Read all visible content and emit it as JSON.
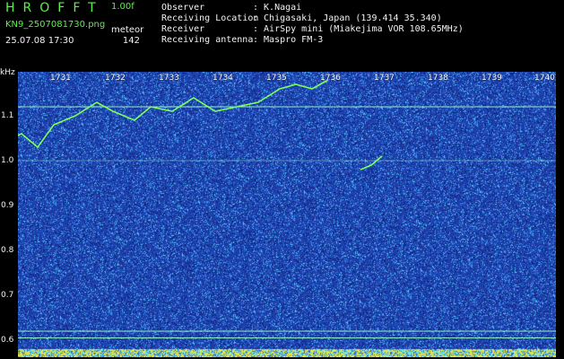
{
  "header": {
    "app_title": "HROFFT",
    "version": "1.00f",
    "filename": "KN9_2507081730.png",
    "meteor_label": "meteor",
    "datetime": "25.07.08 17:30",
    "meteor_count": "142",
    "info": [
      {
        "key": "Observer",
        "value": ": K.Nagai"
      },
      {
        "key": "Receiving Location",
        "value": ": Chigasaki, Japan (139.414 35.340)"
      },
      {
        "key": "Receiver",
        "value": ": AirSpy mini (Miakejima VOR 108.65MHz)"
      },
      {
        "key": "Receiving antenna",
        "value": ": Maspro FM-3"
      }
    ]
  },
  "chart_data": {
    "type": "heatmap",
    "ylabel": "kHz",
    "y_ticks": [
      "1.1",
      "1.0",
      "0.9",
      "0.8",
      "0.7",
      "0.6"
    ],
    "x_ticks": [
      "1731",
      "1732",
      "1733",
      "1734",
      "1735",
      "1736",
      "1737",
      "1738",
      "1739",
      "1740"
    ],
    "ylim": [
      0.58,
      1.2
    ],
    "reference_lines_khz": [
      1.12,
      1.0,
      0.62,
      0.605
    ],
    "colors": {
      "background": "#1c3aa3",
      "noise_light": "#4fb8ff",
      "noise_dark": "#0b1f73",
      "signal": "#7cff5a",
      "line": "#9fffc8",
      "axis_text": "#ffffff"
    },
    "traces": [
      {
        "x": [
          1730.0,
          1730.2,
          1730.5,
          1730.8,
          1731.2,
          1731.6,
          1731.9,
          1732.3,
          1732.6,
          1733.0,
          1733.4,
          1733.8,
          1734.2,
          1734.6,
          1735.0,
          1735.3,
          1735.6,
          1735.9
        ],
        "y": [
          1.05,
          1.06,
          1.03,
          1.08,
          1.1,
          1.13,
          1.11,
          1.09,
          1.12,
          1.11,
          1.14,
          1.11,
          1.12,
          1.13,
          1.16,
          1.17,
          1.16,
          1.18
        ]
      },
      {
        "x": [
          1736.5,
          1736.7,
          1736.9
        ],
        "y": [
          0.98,
          0.99,
          1.01
        ]
      }
    ]
  }
}
